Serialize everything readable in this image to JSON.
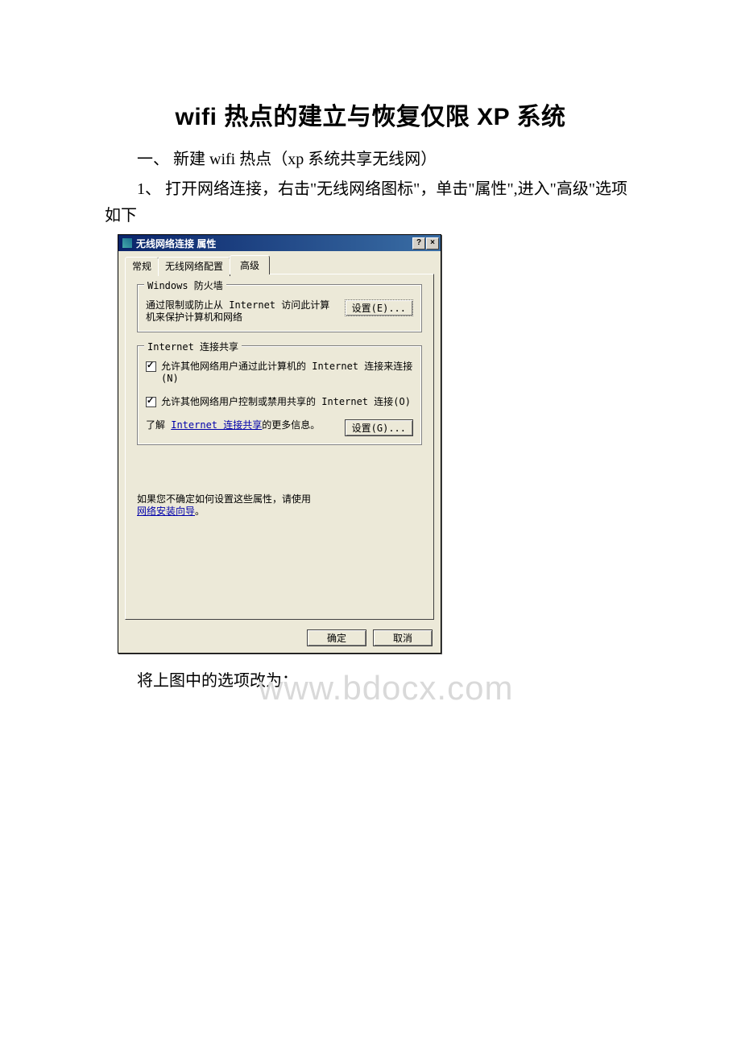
{
  "doc": {
    "title": "wifi 热点的建立与恢复仅限 XP 系统",
    "section_heading": "一、 新建 wifi 热点（xp 系统共享无线网）",
    "step1": "1、 打开网络连接，右击\"无线网络图标\"，单击\"属性\",进入\"高级\"选项如下",
    "caption_below": "将上图中的选项改为：",
    "watermark": "www.bdocx.com"
  },
  "dialog": {
    "title": "无线网络连接 属性",
    "help_btn": "?",
    "close_btn": "×",
    "tabs": {
      "general": "常规",
      "wireless": "无线网络配置",
      "advanced": "高级"
    },
    "firewall_group": {
      "legend": "Windows 防火墙",
      "text": "通过限制或防止从 Internet 访问此计算机来保护计算机和网络",
      "btn": "设置(E)..."
    },
    "ics_group": {
      "legend": "Internet 连接共享",
      "chk1": "允许其他网络用户通过此计算机的 Internet 连接来连接(N)",
      "chk2": "允许其他网络用户控制或禁用共享的 Internet 连接(O)",
      "more_prefix": "了解 ",
      "more_link": "Internet 连接共享",
      "more_suffix": "的更多信息。",
      "btn": "设置(G)..."
    },
    "hint_prefix": "如果您不确定如何设置这些属性，请使用",
    "hint_link": "网络安装向导",
    "hint_suffix": "。",
    "ok": "确定",
    "cancel": "取消"
  }
}
